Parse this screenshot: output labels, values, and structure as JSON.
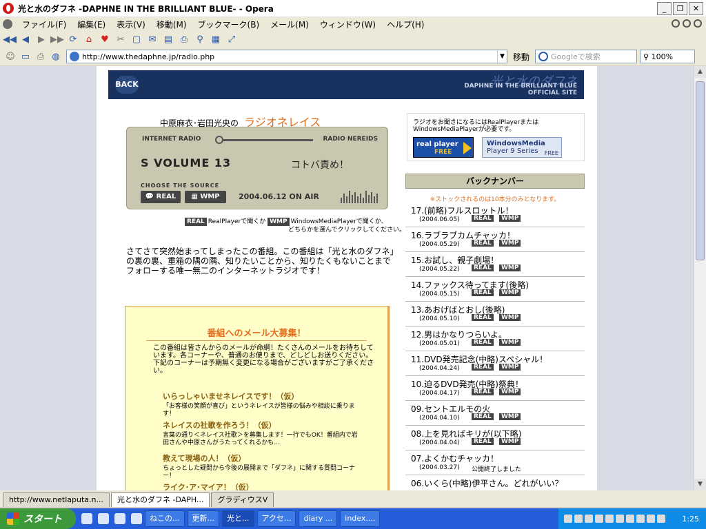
{
  "window": {
    "title": "光と水のダフネ -DAPHNE IN THE BRILLIANT BLUE- - Opera",
    "buttons": [
      "_",
      "❐",
      "✕"
    ]
  },
  "menu": [
    "ファイル(F)",
    "編集(E)",
    "表示(V)",
    "移動(M)",
    "ブックマーク(B)",
    "メール(M)",
    "ウィンドウ(W)",
    "ヘルプ(H)"
  ],
  "toolbar": {
    "address": "http://www.thedaphne.jp/radio.php",
    "go_label": "移動",
    "search_placeholder": "Googleで検索",
    "zoom": "100%"
  },
  "page": {
    "banner": {
      "back": "BACK",
      "logo": "光と水のダフネ",
      "sub1": "DAPHNE IN THE BRILLIANT BLUE",
      "sub2": "OFFICIAL SITE"
    },
    "radio_title_prefix": "中原麻衣･岩田光央の",
    "radio_title": "ラジオネレイス",
    "player": {
      "internet_radio": "INTERNET RADIO",
      "radio_nereids": "RADIO NEREIDS",
      "volume": "S VOLUME 13",
      "episode": "コトバ責め！",
      "choose": "CHOOSE THE SOURCE",
      "real": "REAL",
      "wmp": "WMP",
      "date": "2004.06.12 ON AIR",
      "eq_levels": [
        0.4,
        0.7,
        0.5,
        0.9,
        0.6,
        0.8,
        0.5,
        0.7,
        0.4,
        0.9,
        0.6,
        0.8,
        0.5,
        0.7
      ]
    },
    "player_note": {
      "real_tag": "REAL",
      "real_text": "RealPlayerで聞くか",
      "wmp_tag": "WMP",
      "wmp_text": "WindowsMediaPlayerで聞くか、",
      "line2": "どちらかを選んでクリックしてください。"
    },
    "intro": "さてさて突然始まってしまったこの番組。この番組は「光と水のダフネ」の裏の裏、重箱の隅の隅、知りたいことから、知りたくもないことまでフォローする唯一無二のインターネットラジオです！",
    "mail": {
      "title": "番組へのメール大募集！",
      "body": "この番組は皆さんからのメールが命綱！たくさんのメールをお待ちしています。各コーナーや、普通のお便りまで、どしどしお送りください。下記のコーナーは予期無く変更になる場合がございますがご了承ください。",
      "corners": [
        {
          "title": "いらっしゃいませネレイスです！（仮）",
          "desc": "「お客様の笑顔が喜び」というネレイスが皆様の悩みや相談に乗ります！"
        },
        {
          "title": "ネレイスの社歌を作ろう！（仮）",
          "desc": "言葉の通り＜ネレイス社歌＞を募集します！一行でもOK！番組内で岩田さんや中原さんがうたってくれるかも…"
        },
        {
          "title": "教えて現場の人！（仮）",
          "desc": "ちょっとした疑問から今後の展開まで「ダフネ」に関する質問コーナー！"
        },
        {
          "title": "ライク･ア･マイア！（仮）",
          "desc": ""
        }
      ]
    },
    "players_box": {
      "text": "ラジオをお聞きになるにはRealPlayerまたはWindowsMediaPlayerが必要です。",
      "real_top": "real player",
      "real_free": "FREE",
      "wmp_l1": "WindowsMedia",
      "wmp_l2": "Player 9 Series",
      "wmp_free": "FREE"
    },
    "backnumber": {
      "title": "バックナンバー",
      "note": "※ストックされるのは10本分のみとなります。",
      "real_tag": "REAL",
      "wmp_tag": "WMP",
      "items": [
        {
          "title": "17.(前略)フルスロットル！",
          "date": "(2004.06.05)",
          "public": ""
        },
        {
          "title": "16.ラブラブカムチャッカ！",
          "date": "(2004.05.29)",
          "public": ""
        },
        {
          "title": "15.お試し、親子劇場！",
          "date": "(2004.05.22)",
          "public": ""
        },
        {
          "title": "14.ファックス待ってます(後略)",
          "date": "(2004.05.15)",
          "public": ""
        },
        {
          "title": "13.あおげばとおし(後略)",
          "date": "(2004.05.10)",
          "public": ""
        },
        {
          "title": "12.男はかなりつらいよ。",
          "date": "(2004.05.01)",
          "public": ""
        },
        {
          "title": "11.DVD発売記念(中略)スペシャル！",
          "date": "(2004.04.24)",
          "public": ""
        },
        {
          "title": "10.迫るDVD発売(中略)祭典！",
          "date": "(2004.04.17)",
          "public": ""
        },
        {
          "title": "09.セントエルモの火",
          "date": "(2004.04.10)",
          "public": ""
        },
        {
          "title": "08.上を見ればキリが(以下略)",
          "date": "(2004.04.04)",
          "public": ""
        },
        {
          "title": "07.よくかむチャッカ！",
          "date": "(2004.03.27)",
          "public": "公開終了しました"
        },
        {
          "title": "06.いくら(中略)伊平さん。どれがいい？",
          "date": "",
          "public": ""
        }
      ]
    }
  },
  "tabs": [
    {
      "label": "http://www.netlaputa.n...",
      "active": false
    },
    {
      "label": "光と水のダフネ -DAPH...",
      "active": true
    },
    {
      "label": "グラディウスV",
      "active": false
    }
  ],
  "taskbar": {
    "start": "スタート",
    "tasks": [
      {
        "label": "ねこの...",
        "active": false
      },
      {
        "label": "更新...",
        "active": false
      },
      {
        "label": "光と...",
        "active": true
      },
      {
        "label": "アクセ...",
        "active": false
      },
      {
        "label": "diary ...",
        "active": false
      },
      {
        "label": "index....",
        "active": false
      }
    ],
    "clock": "1:25"
  }
}
